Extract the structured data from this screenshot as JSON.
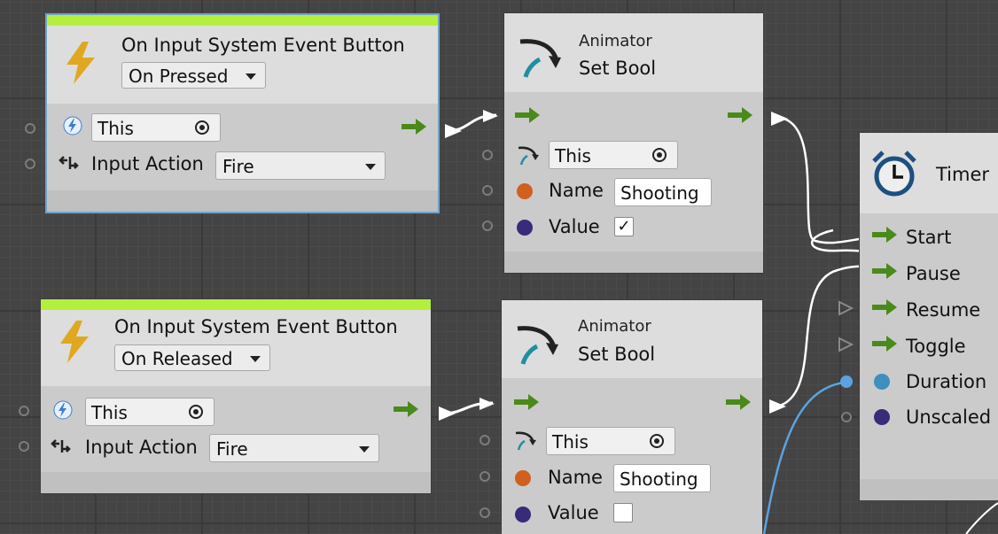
{
  "colors": {
    "flow_green": "#4a8a1a",
    "name_dot": "#d06020",
    "value_dot": "#3a2a7a",
    "duration_dot": "#3d8fc0",
    "header_bar": "#b5ef3e"
  },
  "nodes": {
    "event_pressed": {
      "title": "On Input System Event Button",
      "mode": "On Pressed",
      "target": "This",
      "input_action_label": "Input Action",
      "input_action_value": "Fire",
      "icon": "lightning-bolt-icon"
    },
    "event_released": {
      "title": "On Input System Event Button",
      "mode": "On Released",
      "target": "This",
      "input_action_label": "Input Action",
      "input_action_value": "Fire",
      "icon": "lightning-bolt-icon"
    },
    "setbool_top": {
      "title": "Animator",
      "subtitle": "Set Bool",
      "target": "This",
      "name_label": "Name",
      "name_value": "Shooting",
      "value_label": "Value",
      "value_checked": true,
      "check_mark": "✓"
    },
    "setbool_bottom": {
      "title": "Animator",
      "subtitle": "Set Bool",
      "target": "This",
      "name_label": "Name",
      "name_value": "Shooting",
      "value_label": "Value",
      "value_checked": false,
      "check_mark": ""
    },
    "timer": {
      "title": "Timer",
      "icon": "alarm-clock-icon",
      "ports": [
        "Start",
        "Pause",
        "Resume",
        "Toggle",
        "Duration",
        "Unscaled"
      ]
    }
  }
}
